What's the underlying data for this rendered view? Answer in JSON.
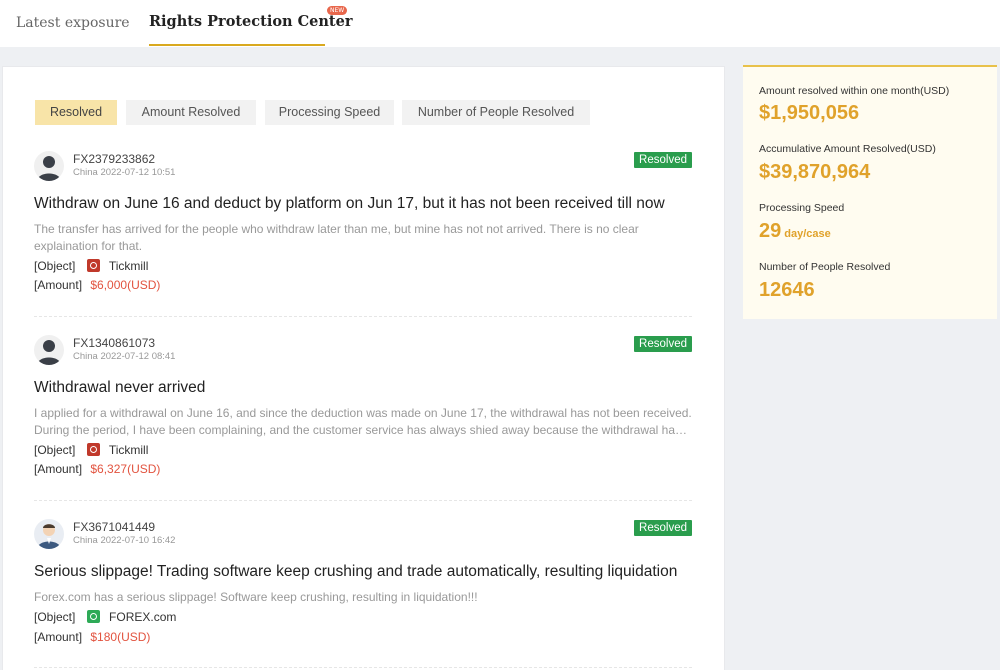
{
  "tabs": {
    "latest": "Latest exposure",
    "rights": "Rights Protection Center",
    "new_badge": "NEW"
  },
  "filters": [
    "Resolved",
    "Amount Resolved",
    "Processing Speed",
    "Number of People Resolved"
  ],
  "complaints": [
    {
      "user_id": "FX2379233862",
      "meta": "China 2022-07-12 10:51",
      "status": "Resolved",
      "title": "Withdraw on June 16 and deduct by platform on Jun 17, but it has not been received till now",
      "description": "The transfer has arrived for the people who withdraw later than me, but mine has not not arrived. There is no clear explaination for that.",
      "object_label": "[Object]",
      "broker": "Tickmill",
      "broker_color": "#c0392b",
      "amount_label": "[Amount]",
      "amount": "$6,000(USD)"
    },
    {
      "user_id": "FX1340861073",
      "meta": "China 2022-07-12 08:41",
      "status": "Resolved",
      "title": "Withdrawal never arrived",
      "description": "I applied for a withdrawal on June 16, and since the deduction was made on June 17, the withdrawal has not been received. During the period, I have been complaining, and the customer service has always shied away because the withdrawal has been processed.",
      "object_label": "[Object]",
      "broker": "Tickmill",
      "broker_color": "#c0392b",
      "amount_label": "[Amount]",
      "amount": "$6,327(USD)"
    },
    {
      "user_id": "FX3671041449",
      "meta": "China 2022-07-10 16:42",
      "status": "Resolved",
      "title": "Serious slippage! Trading software keep crushing and trade automatically, resulting liquidation",
      "description": "Forex.com has a serious slippage! Software keep crushing, resulting in liquidation!!!",
      "object_label": "[Object]",
      "broker": "FOREX.com",
      "broker_color": "#2eaa57",
      "amount_label": "[Amount]",
      "amount": "$180(USD)"
    }
  ],
  "stats": {
    "month_label": "Amount resolved within one month(USD)",
    "month_value": "$1,950,056",
    "total_label": "Accumulative Amount Resolved(USD)",
    "total_value": "$39,870,964",
    "speed_label": "Processing Speed",
    "speed_value": "29",
    "speed_unit": "day/case",
    "people_label": "Number of People Resolved",
    "people_value": "12646"
  },
  "colors": {
    "accent": "#e0a22b",
    "resolved_green": "#2a9d4d",
    "amount_red": "#e2533f"
  }
}
